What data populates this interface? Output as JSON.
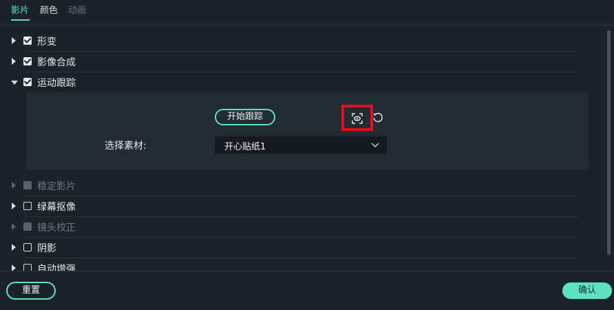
{
  "tabs": [
    {
      "label": "影片",
      "state": "active"
    },
    {
      "label": "颜色",
      "state": "normal"
    },
    {
      "label": "动画",
      "state": "disabled"
    }
  ],
  "sections": {
    "transform": {
      "label": "形变",
      "checked": true
    },
    "compositing": {
      "label": "影像合成",
      "checked": true
    },
    "motion_tracking": {
      "label": "运动跟踪",
      "checked": true,
      "expanded": true
    },
    "stabilization": {
      "label": "稳定影片",
      "checked": false,
      "enabled": false
    },
    "chroma_key": {
      "label": "绿幕抠像",
      "checked": false
    },
    "lens_correction": {
      "label": "镜头校正",
      "checked": false,
      "enabled": false
    },
    "shadow": {
      "label": "阴影",
      "checked": false
    },
    "auto_enhance": {
      "label": "自动增强",
      "checked": false
    }
  },
  "motion_tracking": {
    "start_button": "开始跟踪",
    "select_label": "选择素材:",
    "select_value": "开心贴纸1"
  },
  "footer": {
    "reset_label": "重置",
    "ok_label": "确认"
  },
  "colors": {
    "accent": "#5de3c4",
    "background": "#1b222a",
    "highlight": "#e0101a"
  }
}
